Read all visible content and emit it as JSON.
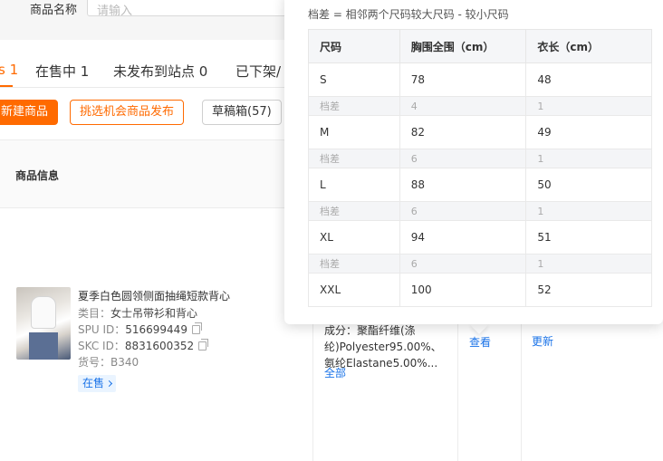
{
  "filter": {
    "label": "商品名称",
    "placeholder": "请输入"
  },
  "tabs": [
    {
      "label": "s 1"
    },
    {
      "label": "在售中 1"
    },
    {
      "label": "未发布到站点 0"
    },
    {
      "label": "已下架/"
    }
  ],
  "buttons": {
    "create": "新建商品",
    "pick_opportunity": "挑选机会商品发布",
    "drafts": "草稿箱(57)"
  },
  "table": {
    "header_product": "商品信息"
  },
  "product": {
    "title": "夏季白色圆领侧面抽绳短款背心",
    "category_label": "类目：",
    "category_value": "女士吊带衫和背心",
    "spu_label": "SPU ID：",
    "spu_value": "516699449",
    "skc_label": "SKC ID：",
    "skc_value": "8831600352",
    "sku_label": "货号：",
    "sku_value": "B340",
    "status": "在售"
  },
  "material": {
    "text": "成分：聚酯纤维(涤纶)Polyester95.00%、氨纶Elastane5.00%...",
    "more": "全部"
  },
  "links": {
    "view": "查看",
    "update": "更新"
  },
  "size_popover": {
    "note": "档差 = 相邻两个尺码较大尺码 - 较小尺码",
    "headers": [
      "尺码",
      "胸围全围（cm）",
      "衣长（cm）"
    ],
    "diff_label": "档差",
    "rows": [
      {
        "size": "S",
        "chest": "78",
        "length": "48"
      },
      {
        "diff": true,
        "chest": "4",
        "length": "1"
      },
      {
        "size": "M",
        "chest": "82",
        "length": "49"
      },
      {
        "diff": true,
        "chest": "6",
        "length": "1"
      },
      {
        "size": "L",
        "chest": "88",
        "length": "50"
      },
      {
        "diff": true,
        "chest": "6",
        "length": "1"
      },
      {
        "size": "XL",
        "chest": "94",
        "length": "51"
      },
      {
        "diff": true,
        "chest": "6",
        "length": "1"
      },
      {
        "size": "XXL",
        "chest": "100",
        "length": "52"
      }
    ]
  }
}
